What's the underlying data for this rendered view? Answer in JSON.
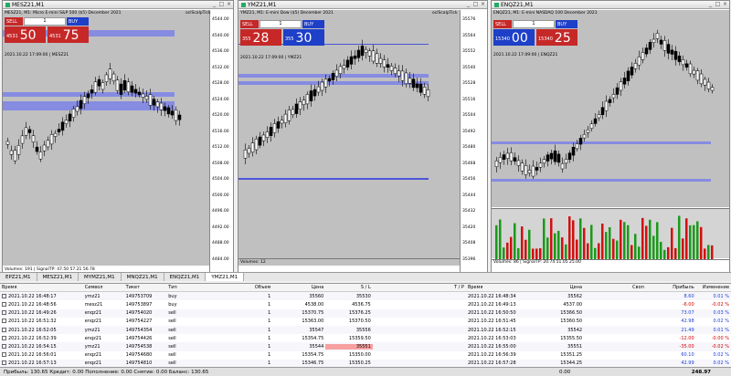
{
  "windows": [
    {
      "tab": "MESZ21,M1",
      "header": "MESZ21, M1: Micro E-mini S&P 500 ($5) December 2021",
      "tag": "oclScalpTick",
      "info": "2021.10.22 17:09:00 | MESZ21",
      "trade": {
        "sell": "SELL",
        "buy": "BUY",
        "vol": "1",
        "bid_small": "4531",
        "bid_big": "50",
        "ask_small": "4531",
        "ask_big": "75"
      },
      "axis": [
        "4544.00",
        "4540.00",
        "4536.00",
        "4532.00",
        "4528.00",
        "4524.00",
        "4520.00",
        "4516.00",
        "4512.00",
        "4508.00",
        "4504.00",
        "4500.00",
        "4496.00",
        "4492.00",
        "4488.00",
        "4484.00"
      ],
      "footer": "Volumes: 191 | SignalTP: 47.50 57.21 56.78"
    },
    {
      "tab": "YMZ21,M1",
      "header": "YMZ21, M1: E-mini Dow ($5) December 2021",
      "tag": "oclScalpTick",
      "info": "2021.10.22 17:09:00 | YMZ21",
      "trade": {
        "sell": "SELL",
        "buy": "BUY",
        "vol": "1",
        "bid_small": "355",
        "bid_big": "28",
        "ask_small": "355",
        "ask_big": "30"
      },
      "axis": [
        "35576",
        "35564",
        "35552",
        "35540",
        "35528",
        "35516",
        "35504",
        "35492",
        "35480",
        "35468",
        "35456",
        "35444",
        "35432",
        "35420",
        "35408",
        "35396"
      ],
      "footer": "Volumes: 12"
    },
    {
      "tab": "ENQZ21,M1",
      "header": "ENQZ21, M1: E-mini NASDAQ 100 December 2021",
      "tag": "",
      "info": "2021.10.22 17:09:00 | ENQZ21",
      "trade": {
        "sell": "SELL",
        "buy": "BUY",
        "vol": "1",
        "bid_small": "15340",
        "bid_big": "00",
        "ask_small": "15340",
        "ask_big": "25"
      },
      "axis": [],
      "footer": "Volumes: 86 | SignalTP: 20.74 51.05 25.00"
    }
  ],
  "tabs": [
    "EPZ21,M1",
    "MESZ21,M1",
    "MYMZ21,M1",
    "MNQZ21,M1",
    "ENQZ21,M1",
    "YMZ21,M1"
  ],
  "active_tab": "YMZ21,M1",
  "columns": [
    "Время",
    "Символ",
    "Тикет",
    "Тип",
    "Объем",
    "Цена",
    "S / L",
    "T / P",
    "Время",
    "Цена",
    "Своп",
    "Прибыль",
    "Изменение"
  ],
  "rows": [
    [
      "2021.10.22 16:48:17",
      "ymz21",
      "149753709",
      "buy",
      "1",
      "35560",
      "35530",
      "",
      "2021.10.22 16:48:34",
      "35562",
      "",
      "8.60",
      "0.01 %"
    ],
    [
      "2021.10.22 16:48:56",
      "mesz21",
      "149753897",
      "buy",
      "1",
      "4538.00",
      "4536.75",
      "",
      "2021.10.22 16:49:13",
      "4537.00",
      "",
      "-6.00",
      "-0.02 %"
    ],
    [
      "2021.10.22 16:49:26",
      "enqz21",
      "149754020",
      "sell",
      "1",
      "15370.75",
      "15376.25",
      "",
      "2021.10.22 16:50:50",
      "15366.50",
      "",
      "73.07",
      "0.03 %"
    ],
    [
      "2021.10.22 16:51:32",
      "enqz21",
      "149754227",
      "sell",
      "1",
      "15363.00",
      "15370.50",
      "",
      "2021.10.22 16:51:45",
      "15360.50",
      "",
      "42.98",
      "0.02 %"
    ],
    [
      "2021.10.22 16:52:05",
      "ymz21",
      "149754354",
      "sell",
      "1",
      "35547",
      "35556",
      "",
      "2021.10.22 16:52:15",
      "35542",
      "",
      "21.49",
      "0.01 %"
    ],
    [
      "2021.10.22 16:52:39",
      "enqz21",
      "149754426",
      "sell",
      "1",
      "15354.75",
      "15359.50",
      "",
      "2021.10.22 16:53:03",
      "15355.50",
      "",
      "-12.00",
      "-0.00 %"
    ],
    [
      "2021.10.22 16:54:15",
      "ymz21",
      "149754538",
      "sell",
      "1",
      "35544",
      "35551",
      "",
      "2021.10.22 16:55:00",
      "35551",
      "",
      "-35.00",
      "-0.02 %"
    ],
    [
      "2021.10.22 16:56:01",
      "enqz21",
      "149754680",
      "sell",
      "1",
      "15354.75",
      "15350.00",
      "",
      "2021.10.22 16:56:39",
      "15351.25",
      "",
      "60.10",
      "0.02 %"
    ],
    [
      "2021.10.22 16:57:13",
      "enqz21",
      "149754810",
      "sell",
      "1",
      "15346.75",
      "15350.25",
      "",
      "2021.10.22 16:57:28",
      "15344.25",
      "",
      "42.99",
      "0.02 %"
    ]
  ],
  "status": "Прибыль: 130.65  Кредит: 0.00  Пополнение: 0.00  Снятие: 0.00  Баланс: 130.65",
  "total_swap": "0.00",
  "total_profit": "248.97"
}
